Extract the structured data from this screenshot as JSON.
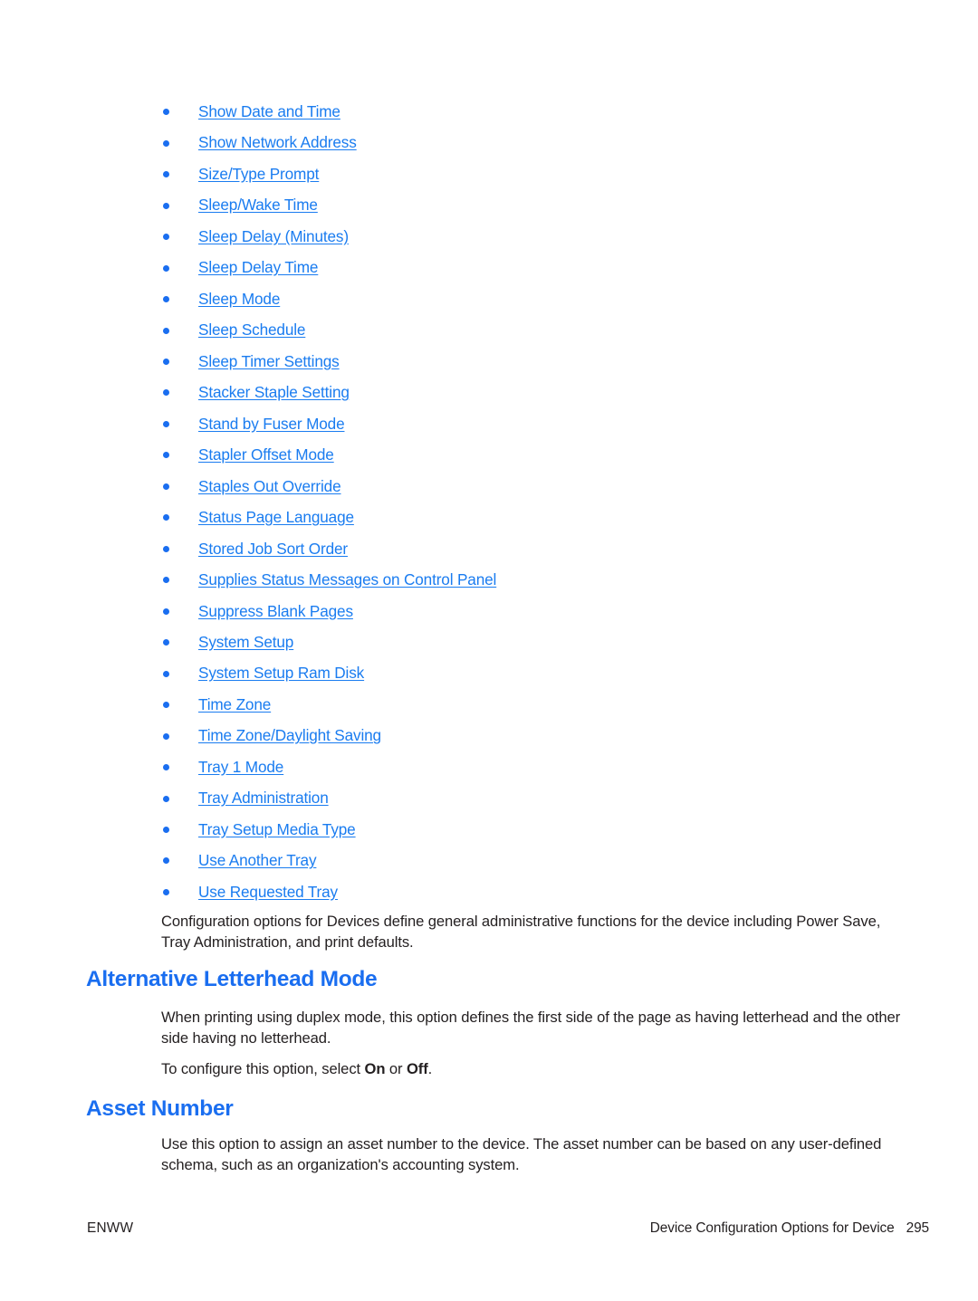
{
  "colors": {
    "link": "#1a7cf0",
    "heading": "#1a6ef0",
    "bullet": "#1a6ef0",
    "body_text": "#231f20",
    "page_background": "#ffffff"
  },
  "option_list": {
    "items": [
      {
        "label": "Show Date and Time"
      },
      {
        "label": "Show Network Address"
      },
      {
        "label": "Size/Type Prompt"
      },
      {
        "label": "Sleep/Wake Time"
      },
      {
        "label": "Sleep Delay (Minutes)"
      },
      {
        "label": "Sleep Delay Time"
      },
      {
        "label": "Sleep Mode"
      },
      {
        "label": "Sleep Schedule"
      },
      {
        "label": "Sleep Timer Settings"
      },
      {
        "label": "Stacker Staple Setting"
      },
      {
        "label": "Stand by Fuser Mode"
      },
      {
        "label": "Stapler Offset Mode"
      },
      {
        "label": "Staples Out Override"
      },
      {
        "label": "Status Page Language"
      },
      {
        "label": "Stored Job Sort Order"
      },
      {
        "label": "Supplies Status Messages on Control Panel"
      },
      {
        "label": "Suppress Blank Pages"
      },
      {
        "label": "System Setup"
      },
      {
        "label": "System Setup Ram Disk"
      },
      {
        "label": "Time Zone"
      },
      {
        "label": "Time Zone/Daylight Saving"
      },
      {
        "label": "Tray 1 Mode"
      },
      {
        "label": "Tray Administration"
      },
      {
        "label": "Tray Setup Media Type"
      },
      {
        "label": "Use Another Tray"
      },
      {
        "label": "Use Requested Tray"
      }
    ]
  },
  "intro_paragraph": {
    "text": "Configuration options for Devices define general administrative functions for the device including Power Save, Tray Administration, and print defaults."
  },
  "sections": [
    {
      "heading": "Alternative Letterhead Mode",
      "paragraph_1": "When printing using duplex mode, this option defines the first side of the page as having letterhead and the other side having no letterhead.",
      "paragraph_2_prefix": "To configure this option, select ",
      "paragraph_2_option_on": "On",
      "paragraph_2_conjunction": " or ",
      "paragraph_2_option_off": "Off",
      "paragraph_2_suffix": "."
    },
    {
      "heading": "Asset Number",
      "paragraph_1": "Use this option to assign an asset number to the device. The asset number can be based on any user-defined schema, such as an organization's accounting system."
    }
  ],
  "footer": {
    "left_label": "ENWW",
    "right_label": "Device Configuration Options for Device",
    "page_number": "295"
  }
}
